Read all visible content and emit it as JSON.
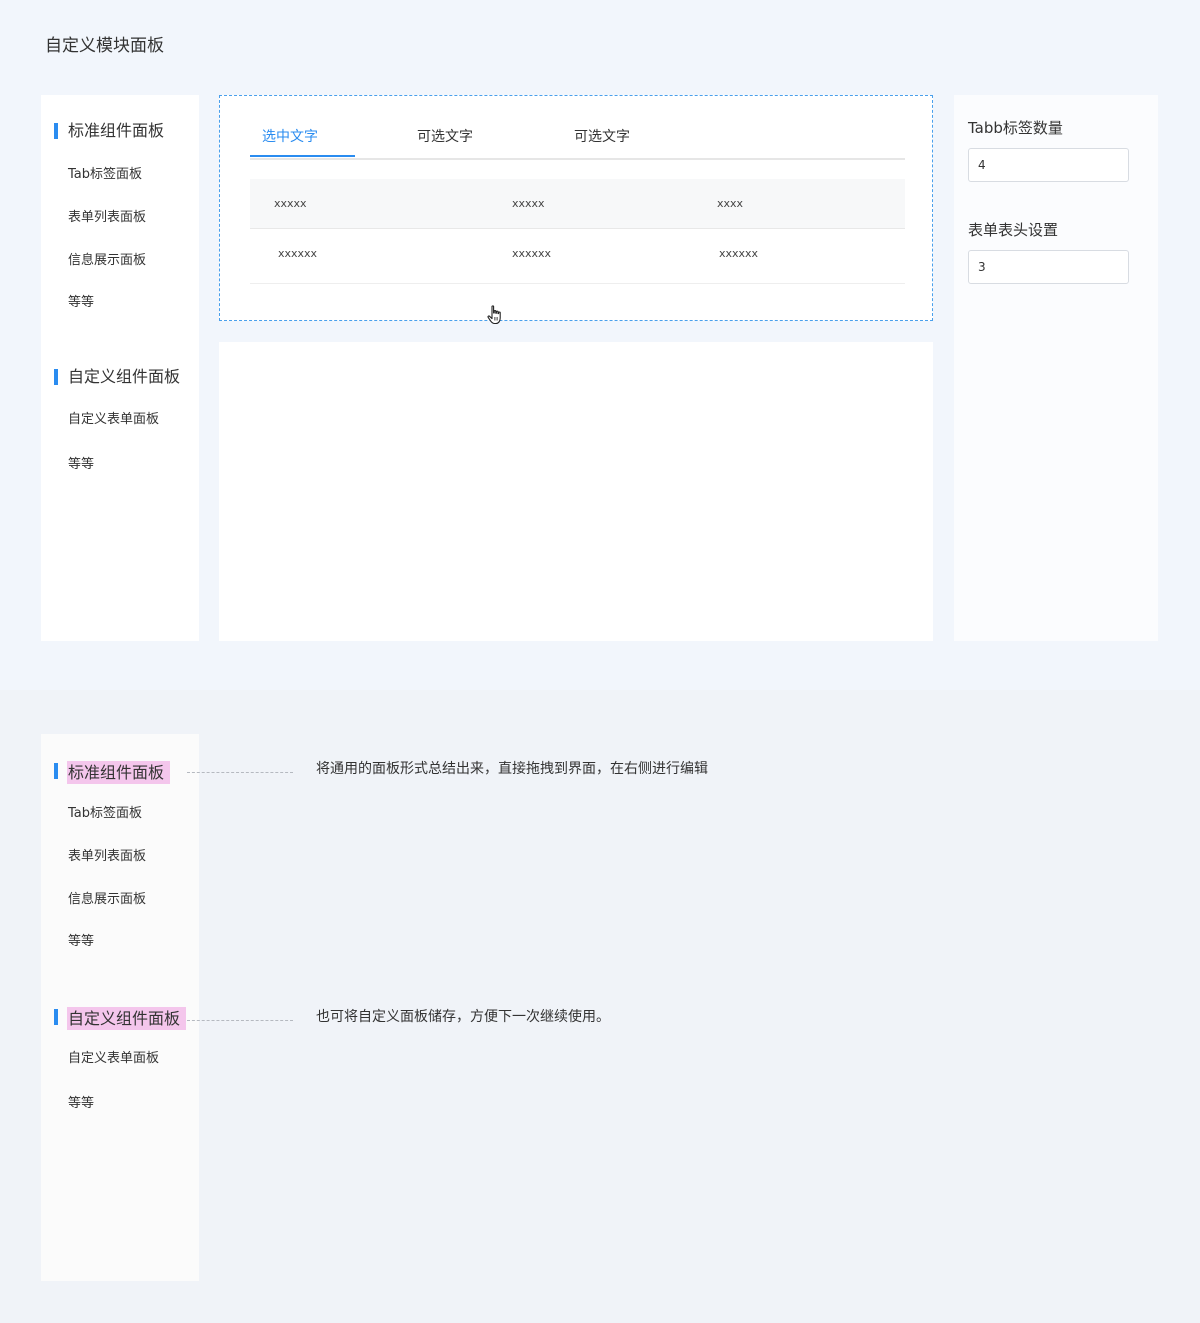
{
  "page_title": "自定义模块面板",
  "left_panel": {
    "groups": [
      {
        "title": "标准组件面板",
        "items": [
          "Tab标签面板",
          "表单列表面板",
          "信息展示面板",
          "等等"
        ]
      },
      {
        "title": "自定义组件面板",
        "items": [
          "自定义表单面板",
          "等等"
        ]
      }
    ]
  },
  "canvas": {
    "tabs": [
      "选中文字",
      "可选文字",
      "可选文字"
    ],
    "active_tab": 0,
    "table": {
      "header": [
        "xxxxx",
        "xxxxx",
        "xxxx"
      ],
      "row": [
        "xxxxxx",
        "xxxxxx",
        "xxxxxx"
      ]
    }
  },
  "properties": {
    "tab_count_label": "Tabb标签数量",
    "tab_count_value": "4",
    "header_setting_label": "表单表头设置",
    "header_setting_value": "3"
  },
  "annotations": [
    "将通用的面板形式总结出来，直接拖拽到界面，在右侧进行编辑",
    "也可将自定义面板储存，方便下一次继续使用。"
  ],
  "colors": {
    "accent": "#2a8cf0",
    "highlight": "#f4c6ec"
  }
}
